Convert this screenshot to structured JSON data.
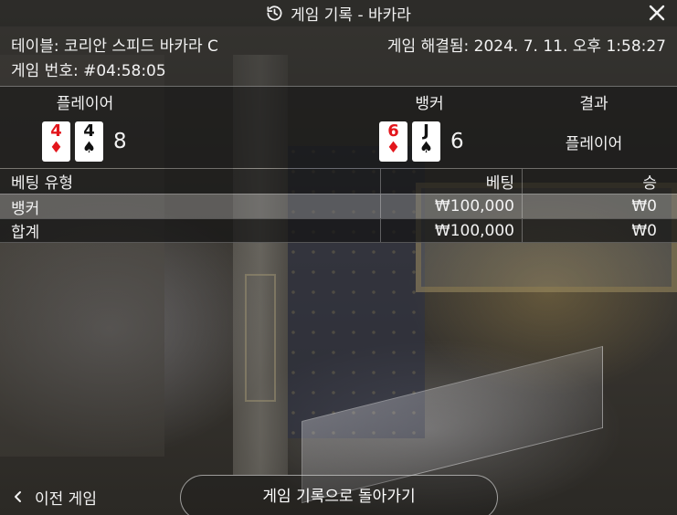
{
  "header": {
    "title": "게임 기록 - 바카라",
    "history_icon": "history-icon",
    "close_icon": "close-icon"
  },
  "info": {
    "table": "테이블: 코리안 스피드 바카라 C",
    "round": "게임 번호: #04:58:05",
    "settled": "게임 해결됨: 2024. 7. 11. 오후 1:58:27"
  },
  "results": {
    "player_label": "플레이어",
    "banker_label": "뱅커",
    "result_label": "결과",
    "player_cards": [
      {
        "rank": "4",
        "suit": "♦",
        "color": "#e3161c"
      },
      {
        "rank": "4",
        "suit": "♠",
        "color": "#111111"
      }
    ],
    "player_score": "8",
    "banker_cards": [
      {
        "rank": "6",
        "suit": "♦",
        "color": "#e3161c"
      },
      {
        "rank": "J",
        "suit": "♠",
        "color": "#111111"
      }
    ],
    "banker_score": "6",
    "result_value": "플레이어"
  },
  "bets": {
    "headers": [
      "베팅 유형",
      "베팅",
      "승"
    ],
    "rows": [
      {
        "type": "뱅커",
        "bet": "₩100,000",
        "win": "₩0"
      },
      {
        "type": "합계",
        "bet": "₩100,000",
        "win": "₩0"
      }
    ]
  },
  "footer": {
    "prev_label": "이전 게임",
    "back_label": "게임 기록으로 돌아가기"
  }
}
